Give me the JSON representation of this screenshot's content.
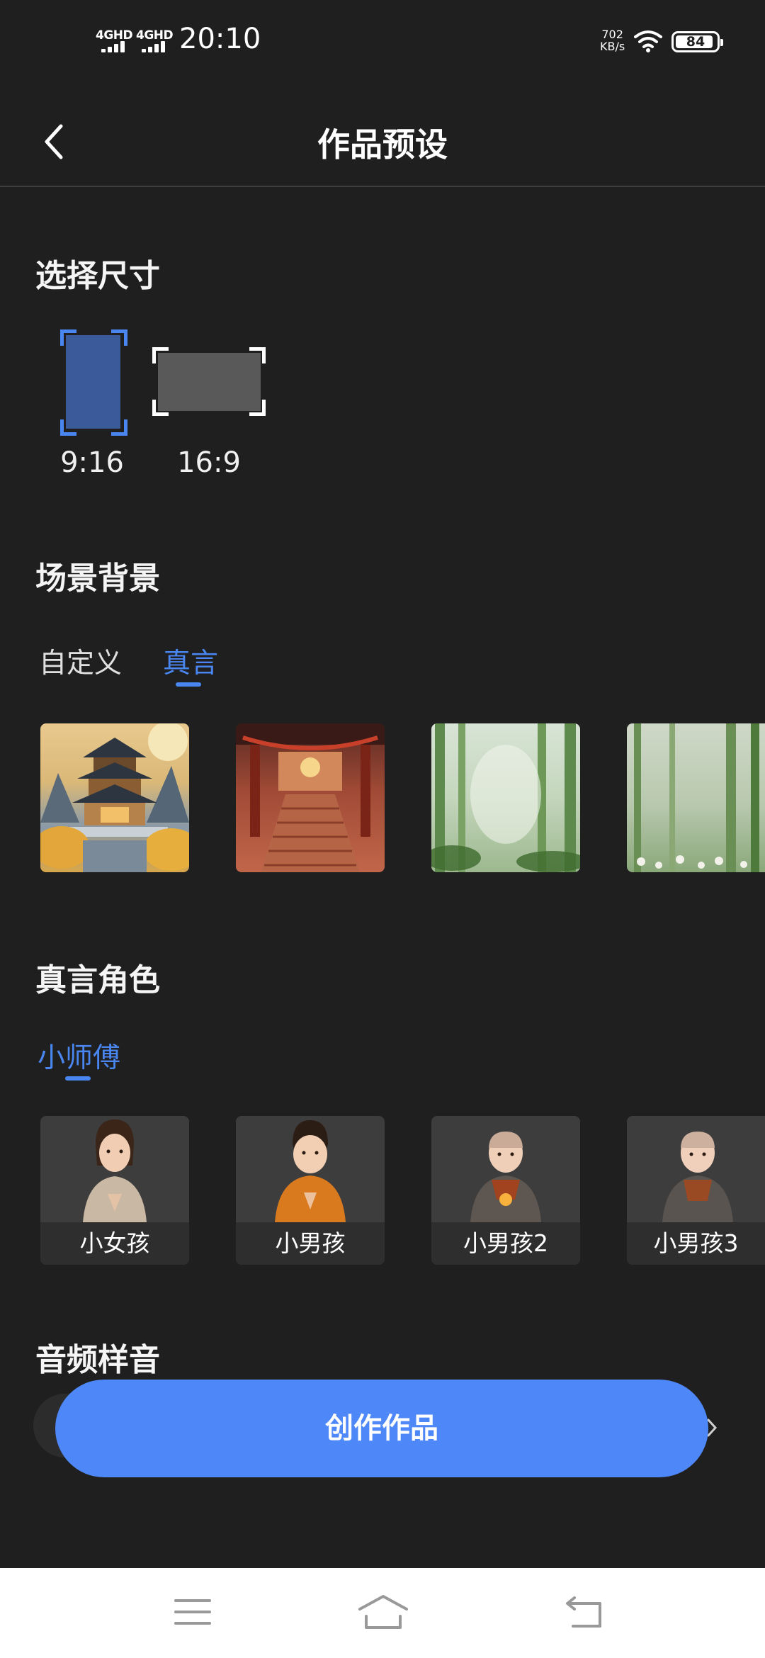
{
  "status_bar": {
    "network1": "4GHD",
    "network2": "4GHD",
    "time": "20:10",
    "speed_value": "702",
    "speed_unit": "KB/s",
    "battery": "84"
  },
  "header": {
    "title": "作品预设"
  },
  "size_section": {
    "title": "选择尺寸",
    "options": [
      {
        "label": "9:16",
        "selected": true
      },
      {
        "label": "16:9",
        "selected": false
      }
    ],
    "accent": "#4a86f0"
  },
  "scene_section": {
    "title": "场景背景",
    "tabs": [
      {
        "label": "自定义",
        "active": false
      },
      {
        "label": "真言",
        "active": true
      }
    ],
    "thumbnails": [
      "pagoda-temple",
      "temple-stairs",
      "bamboo-forest",
      "bamboo-forest-flowers"
    ]
  },
  "role_section": {
    "title": "真言角色",
    "tabs": [
      {
        "label": "小师傅",
        "active": true
      }
    ],
    "characters": [
      {
        "label": "小女孩",
        "avatar": "little-girl"
      },
      {
        "label": "小男孩",
        "avatar": "little-boy"
      },
      {
        "label": "小男孩2",
        "avatar": "little-monk-2"
      },
      {
        "label": "小男孩3",
        "avatar": "little-monk-3"
      }
    ]
  },
  "audio_section": {
    "title": "音频样音"
  },
  "create_button": {
    "label": "创作作品",
    "color": "#4e87f7"
  },
  "nav_bar": {
    "icons": [
      "menu-icon",
      "home-icon",
      "back-icon"
    ]
  }
}
